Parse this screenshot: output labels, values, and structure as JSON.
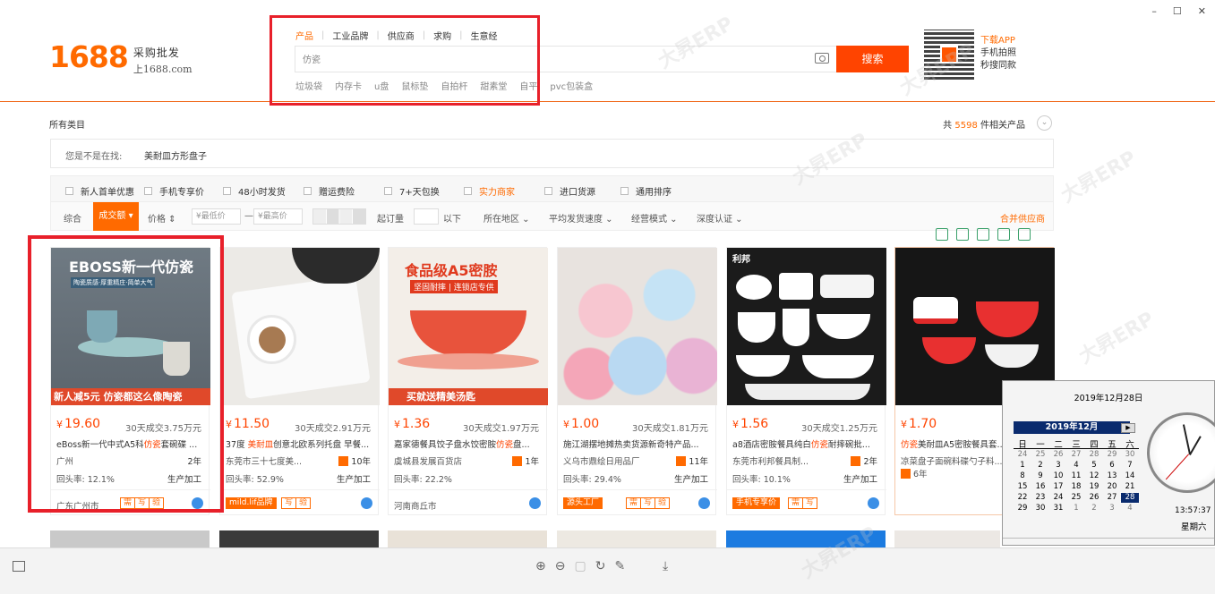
{
  "window": {
    "min": "–",
    "max": "☐",
    "close": "✕"
  },
  "logo": {
    "number": "1688",
    "slogan": "采购批发",
    "domain": "上1688.com"
  },
  "search": {
    "tabs": [
      "产品",
      "工业品牌",
      "供应商",
      "求购",
      "生意经"
    ],
    "value": "仿瓷",
    "button": "搜索",
    "hot_words": [
      "垃圾袋",
      "内存卡",
      "u盘",
      "鼠标垫",
      "自拍杆",
      "甜素堂",
      "自平",
      "pvc包装盒"
    ]
  },
  "app": {
    "title": "下载APP",
    "line1": "手机拍照",
    "line2": "秒搜同款"
  },
  "breadcrumb": "所有类目",
  "results": {
    "prefix": "共",
    "count": "5598",
    "suffix": "件相关产品"
  },
  "suggest": {
    "label": "您是不是在找:",
    "word": "美耐皿方形盘子"
  },
  "filters": [
    "新人首单优惠",
    "手机专享价",
    "48小时发货",
    "赠运费险",
    "7+天包换",
    "实力商家",
    "进口货源",
    "通用排序"
  ],
  "sort": {
    "general": "综合",
    "active": "成交额",
    "price": "价格",
    "min_price": "¥最低价",
    "max_price": "¥最高价",
    "moq_label": "起订量",
    "moq_suffix": "以下",
    "region": "所在地区",
    "speed": "平均发货速度",
    "mode": "经营模式",
    "depth": "深度认证",
    "merge": "合并供应商"
  },
  "products": [
    {
      "image_text": "EBOSS新一代仿瓷",
      "image_sub": "陶瓷质感·厚重精庄·简单大气",
      "image_banner": "新人减5元  仿瓷都这么像陶瓷",
      "price": "19.60",
      "sold": "30天成交3.75万元",
      "title_a": "eBoss新一代中式A5科",
      "title_hl": "仿瓷",
      "title_b": "套碗碟 ...",
      "company": "广州",
      "years": "2年",
      "return_rate": "回头率:  12.1%",
      "production": "生产加工",
      "location": "广东广州市",
      "tags": [
        "需",
        "写",
        "验"
      ]
    },
    {
      "image_text": "",
      "image_sub": "",
      "image_banner": "",
      "price": "11.50",
      "sold": "30天成交2.91万元",
      "title_a": "37度 ",
      "title_hl": "美耐皿",
      "title_b": "创意北欧系列托盘 早餐...",
      "company": "东莞市三十七度美...",
      "years": "10年",
      "return_rate": "回头率:  52.9%",
      "production": "生产加工",
      "location": "",
      "tags": [
        "mild.lif品牌",
        "写",
        "验"
      ]
    },
    {
      "image_text": "食品级A5密胺",
      "image_sub": "坚固耐摔 | 连锁店专供",
      "image_banner": "买就送精美汤匙",
      "price": "1.36",
      "sold": "30天成交1.97万元",
      "title_a": "嘉家德餐具饺子盘水饺密胺",
      "title_hl": "仿瓷",
      "title_b": "盘...",
      "company": "虞城县发展百货店",
      "years": "1年",
      "return_rate": "回头率:  22.2%",
      "production": "",
      "location": "河南商丘市",
      "tags": []
    },
    {
      "image_text": "",
      "image_sub": "",
      "image_banner": "",
      "price": "1.00",
      "sold": "30天成交1.81万元",
      "title_a": "施江湖摆地摊热卖货源新奇特产品...",
      "title_hl": "",
      "title_b": "",
      "company": "义乌市鼎绘日用品厂",
      "years": "11年",
      "return_rate": "回头率:  29.4%",
      "production": "生产加工",
      "location": "",
      "tags": [
        "源头工厂",
        "需",
        "写",
        "验"
      ]
    },
    {
      "image_text": "利邦",
      "image_sub": "",
      "image_banner": "",
      "price": "1.56",
      "sold": "30天成交1.25万元",
      "title_a": "a8酒店密胺餐具纯白",
      "title_hl": "仿瓷",
      "title_b": "耐摔碗批...",
      "company": "东莞市利邦餐具制...",
      "years": "2年",
      "return_rate": "回头率:  10.1%",
      "production": "生产加工",
      "location": "",
      "tags": [
        "手机专享价",
        "需",
        "写"
      ]
    },
    {
      "image_text": "",
      "image_sub": "",
      "image_banner": "",
      "price": "1.70",
      "sold": "",
      "title_a": "",
      "title_hl": "仿瓷",
      "title_b": "美耐皿A5密胺餐具套...",
      "company": "凉菜盘子面碗料碟勺子料...",
      "years": "6年",
      "return_rate": "",
      "production": "",
      "location": "",
      "tags": []
    }
  ],
  "clock": {
    "date": "2019年12月28日",
    "month": "2019年12月",
    "weekdays": [
      "日",
      "一",
      "二",
      "三",
      "四",
      "五",
      "六"
    ],
    "days": [
      "24",
      "25",
      "26",
      "27",
      "28",
      "29",
      "30",
      "1",
      "2",
      "3",
      "4",
      "5",
      "6",
      "7",
      "8",
      "9",
      "10",
      "11",
      "12",
      "13",
      "14",
      "15",
      "16",
      "17",
      "18",
      "19",
      "20",
      "21",
      "22",
      "23",
      "24",
      "25",
      "26",
      "27",
      "28",
      "29",
      "30",
      "31",
      "1",
      "2",
      "3",
      "4"
    ],
    "time": "13:57:37",
    "weekday": "星期六"
  },
  "watermark": "大昇ERP"
}
